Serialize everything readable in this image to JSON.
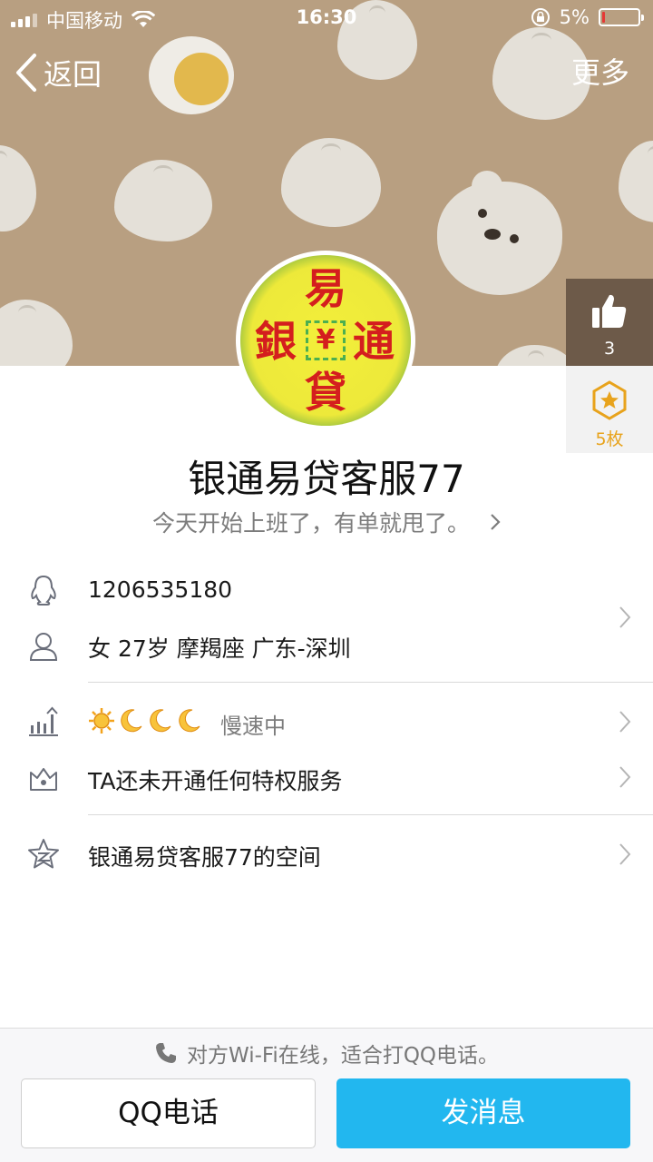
{
  "status_bar": {
    "carrier": "中国移动",
    "time": "16:30",
    "battery": "5%"
  },
  "nav": {
    "back_label": "返回",
    "more_label": "更多"
  },
  "avatar": {
    "chars": [
      "易",
      "銀",
      "通",
      "貸"
    ],
    "center": "¥"
  },
  "like": {
    "count": "3"
  },
  "medal": {
    "count": "5枚"
  },
  "profile": {
    "name": "银通易贷客服77",
    "signature": "今天开始上班了，有单就甩了。"
  },
  "info": {
    "qq_number": "1206535180",
    "details": "女 27岁 摩羯座 广东-深圳",
    "level_status": "慢速中",
    "privilege": "TA还未开通任何特权服务",
    "space": "银通易贷客服77的空间"
  },
  "bottom": {
    "wifi_tip": "对方Wi-Fi在线，适合打QQ电话。",
    "call_label": "QQ电话",
    "message_label": "发消息"
  },
  "colors": {
    "accent": "#22b7ef",
    "cover": "#b89f81",
    "medal": "#e8a31c"
  }
}
